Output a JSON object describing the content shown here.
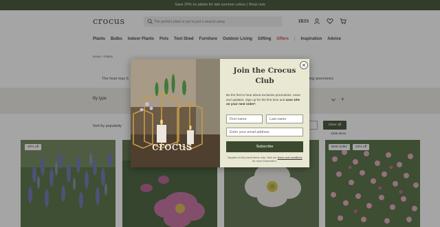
{
  "announcement": "Save 20% on plants for late summer colour | Shop now",
  "header": {
    "logo": "crocus",
    "search_placeholder": "The perfect plant or pot is just a search away",
    "partner_logo": "IRIS"
  },
  "nav": {
    "items": [
      "Plants",
      "Bulbs",
      "Indoor Plants",
      "Pots",
      "Tool Shed",
      "Furniture",
      "Outdoor Living",
      "Gifting",
      "Offers"
    ],
    "separator": "|",
    "extra": [
      "Inspiration",
      "Advice"
    ],
    "offers_color": "#c5453a"
  },
  "breadcrumb": "Home  >  Plants",
  "intro": {
    "left": "The heat may b",
    "right": "ring anemones"
  },
  "filters": {
    "by_type": "By type",
    "plus": "+"
  },
  "sort": {
    "label": "Sort by popularity",
    "clear_all": "clear all",
    "count": "1836 items"
  },
  "products": [
    {
      "badge": "20% off"
    },
    {
      "badge": ""
    },
    {
      "badge": ""
    },
    {
      "badges": [
        "Best Seller",
        "20% off"
      ]
    }
  ],
  "modal": {
    "brand": "crocus",
    "title": "Join the Crocus Club",
    "text": "Be the first to hear about exclusive promotions, news and updates. Sign up for the first time and",
    "text_bold": "save 10% on your next order*.",
    "first_name_placeholder": "First name",
    "last_name_placeholder": "Last name",
    "email_placeholder": "Enter your email address",
    "subscribe": "Subscribe",
    "fine_print_pre": "*Applies to full-priced items only. View our",
    "fine_print_link": "terms and conditions",
    "fine_print_post": "for more information.",
    "close": "×"
  },
  "colors": {
    "accent_green": "#3b4a2e",
    "modal_bg": "#e9e8d2"
  },
  "icons": [
    "search-icon",
    "user-icon",
    "heart-icon",
    "basket-icon",
    "close-icon",
    "chevron-down-icon"
  ]
}
